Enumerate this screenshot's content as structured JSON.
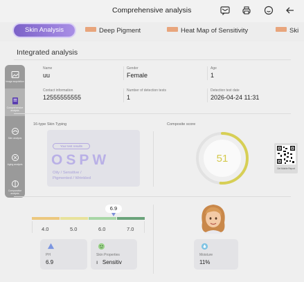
{
  "header": {
    "title": "Comprehensive analysis",
    "icons": [
      "message-icon",
      "print-icon",
      "chat-bubble-icon",
      "back-arrow-icon"
    ]
  },
  "tabs": [
    {
      "label": "Skin Analysis",
      "active": true
    },
    {
      "label": "Deep Pigment",
      "badge": "PRO"
    },
    {
      "label": "Heat Map of Sensitivity",
      "badge": "PRO"
    },
    {
      "label": "Ski",
      "badge": "PRO"
    }
  ],
  "section_title": "Integrated analysis",
  "sidebar": {
    "items": [
      {
        "label": "Image acquisition",
        "icon": "image-icon"
      },
      {
        "label": "Comprehensive analysis",
        "icon": "analysis-icon",
        "active": true
      },
      {
        "label": "Skin analysis",
        "icon": "skin-icon"
      },
      {
        "label": "Aging analysis",
        "icon": "aging-icon"
      },
      {
        "label": "Comparative analysis",
        "icon": "compare-icon"
      }
    ]
  },
  "patient": {
    "name_label": "Name",
    "name": "uu",
    "gender_label": "Gender",
    "gender": "Female",
    "age_label": "Age",
    "age": "1",
    "contact_label": "Contact information",
    "contact": "12555555555",
    "tests_label": "Number of detection tests",
    "tests": "1",
    "date_label": "Detection test date",
    "date": "2026-04-24 11:31"
  },
  "skin_typing": {
    "title": "16-type Skin Typing",
    "pill": "Your test results",
    "code": "OSPW",
    "desc_line1": "Oily / Sensitive /",
    "desc_line2": "Pigmented / Wrinkled"
  },
  "composite": {
    "title": "Composite score",
    "score": "51",
    "score_fraction": 0.51,
    "ring_color": "#d7cf55",
    "qr_label": "Get Mobile Report"
  },
  "ph_scale": {
    "current": "6.9",
    "ticks": [
      "4.0",
      "5.0",
      "6.0",
      "7.0"
    ],
    "colors": [
      "#ecc87e",
      "#e8e29b",
      "#a8d6a6",
      "#6aa37a"
    ]
  },
  "metrics": [
    {
      "label": "PH",
      "value": "6.9",
      "icon": "ph-drop-icon"
    },
    {
      "label": "Skin Properties",
      "value": "ı   Sensitiv",
      "icon": "skin-face-icon"
    },
    {
      "label": "Moisture",
      "value": "11%",
      "icon": "water-drop-icon"
    }
  ]
}
